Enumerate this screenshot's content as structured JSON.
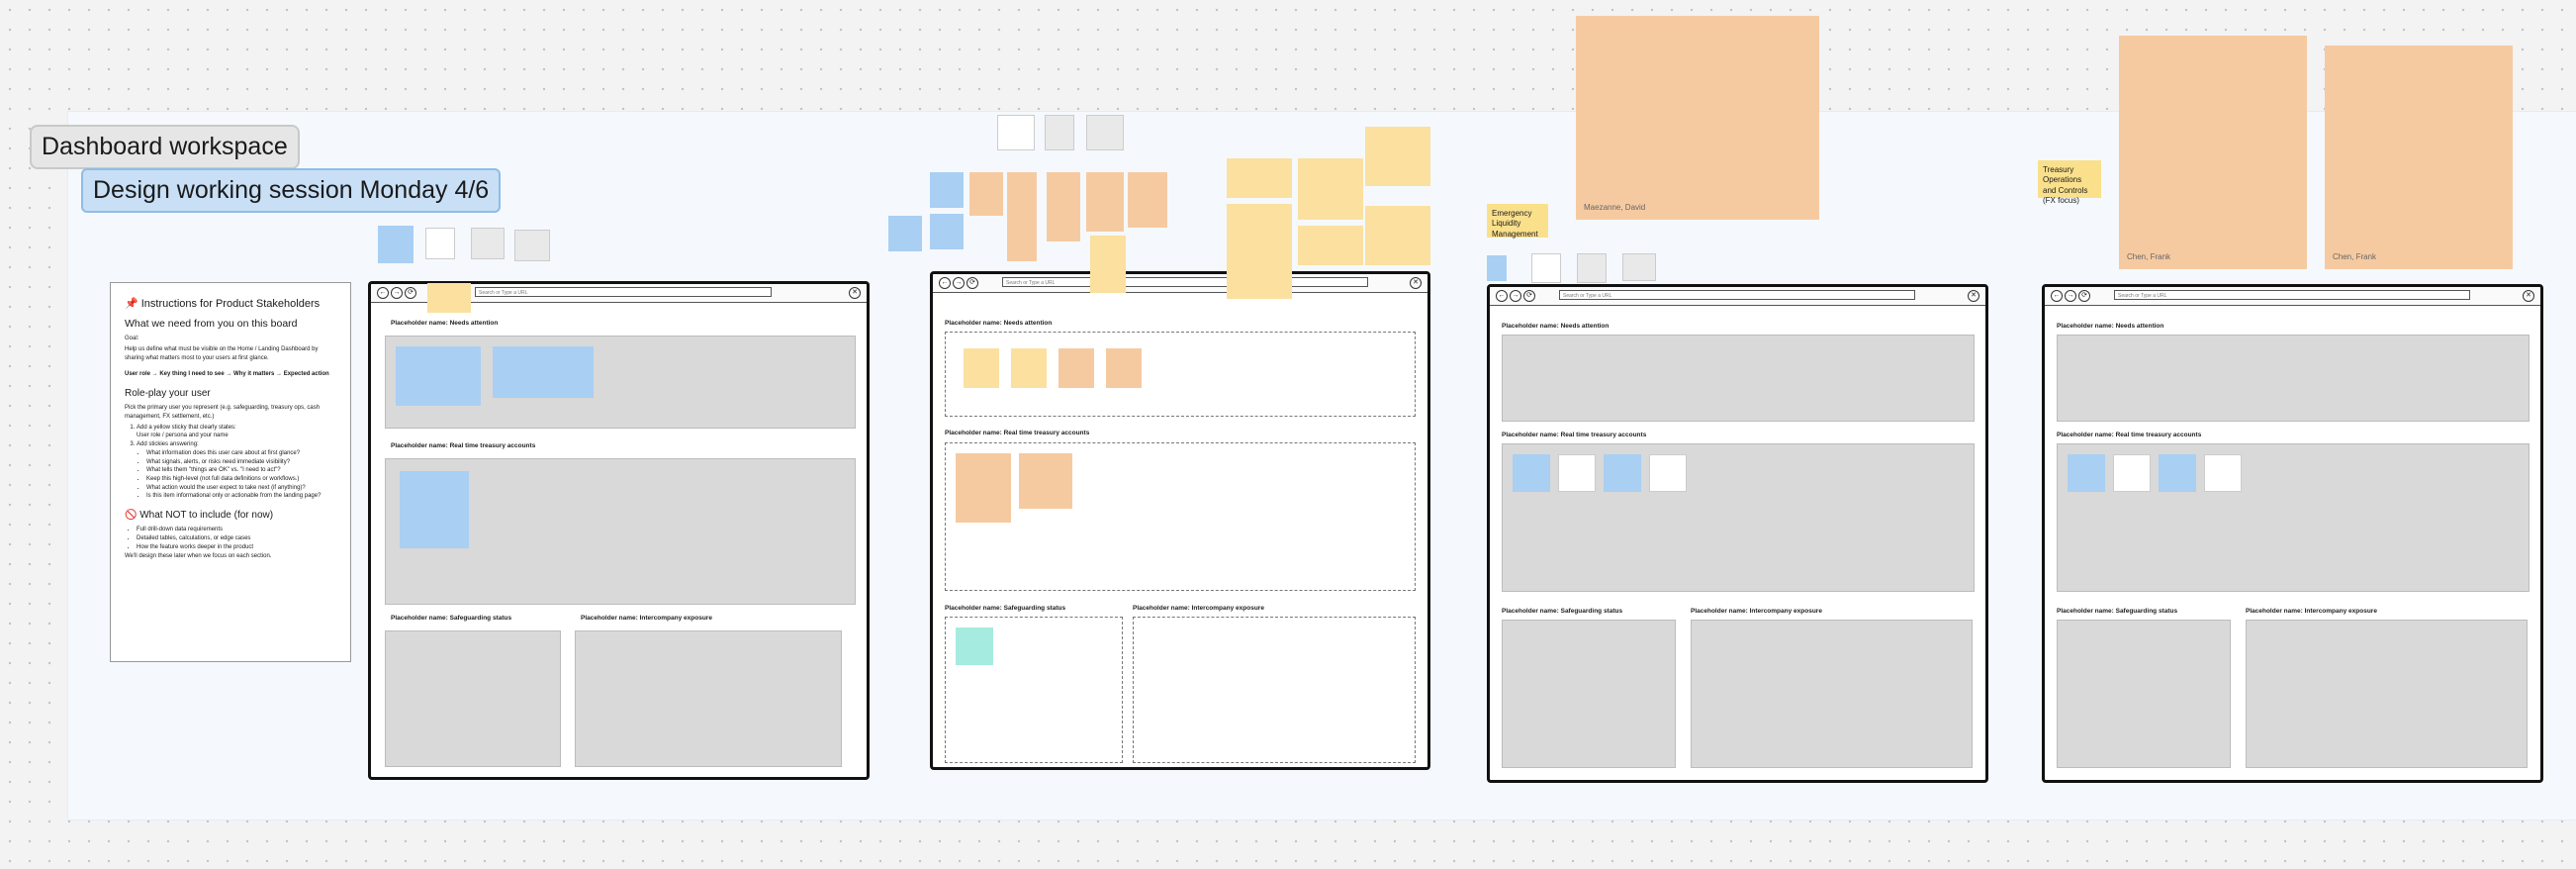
{
  "workspace": {
    "title": "Dashboard workspace",
    "subtitle": "Design working session Monday 4/6"
  },
  "instructions": {
    "heading": "📌 Instructions for Product Stakeholders",
    "what_we_need": "What we need from you on this board",
    "goal_label": "Goal:",
    "goal_text": "Help us define what must be visible on the Home / Landing Dashboard by sharing what matters most to your users at first glance.",
    "rule": "User role → Key thing I need to see → Why it matters → Expected action",
    "roleplay_heading": "Role-play your user",
    "roleplay_text": "Pick the primary user you represent (e.g. safeguarding, treasury ops, cash management, FX settlement, etc.)",
    "steps": [
      "Add a yellow sticky that clearly states:",
      "User role / persona and your name",
      "Add stickies answering:",
      "What information does this user care about at first glance?",
      "What signals, alerts, or risks need immediate visibility?",
      "What tells them \"things are OK\" vs. \"I need to act\"?",
      "Keep this high-level (not full data definitions or workflows.)",
      "What action would the user expect to take next (if anything)?",
      "Is this item informational only or actionable from the landing page?"
    ],
    "not_include_heading": "🚫 What NOT to include (for now)",
    "not_include": [
      "Full drill-down data requirements",
      "Detailed tables, calculations, or edge cases",
      "How the feature works deeper in the product"
    ],
    "footer": "We'll design these later when we focus on each section."
  },
  "browser": {
    "url_placeholder": "Search or Type a URL",
    "back_icon": "←",
    "forward_icon": "→",
    "refresh_icon": "⟳",
    "close_icon": "✕"
  },
  "frames": [
    {
      "needs_attention": "Placeholder name: Needs attention",
      "realtime": "Placeholder name: Real time treasury accounts",
      "safeguarding": "Placeholder name: Safeguarding status",
      "intercompany": "Placeholder name: Intercompany exposure"
    },
    {
      "needs_attention": "Placeholder name: Needs attention",
      "realtime": "Placeholder name: Real time treasury accounts",
      "safeguarding": "Placeholder name: Safeguarding status",
      "intercompany": "Placeholder name: Intercompany exposure"
    },
    {
      "needs_attention": "Placeholder name: Needs attention",
      "realtime": "Placeholder name: Real time treasury accounts",
      "safeguarding": "Placeholder name: Safeguarding status",
      "intercompany": "Placeholder name: Intercompany exposure"
    },
    {
      "needs_attention": "Placeholder name: Needs attention",
      "realtime": "Placeholder name: Real time treasury accounts",
      "safeguarding": "Placeholder name: Safeguarding status",
      "intercompany": "Placeholder name: Intercompany exposure"
    }
  ],
  "labels": {
    "emergency_liquidity": "Emergency Liquidity Management",
    "treasury_ops": "Treasury Operations and Controls (FX focus)",
    "signature_1": "Maezanne, David",
    "signature_2": "Chen, Frank",
    "signature_3": "Chen, Frank"
  },
  "colors": {
    "accent_blue": "#a9cff3",
    "sticky_yellow": "#fbe0a0",
    "sticky_orange": "#f6caa1",
    "subtitle_bg": "#c8dff5"
  }
}
